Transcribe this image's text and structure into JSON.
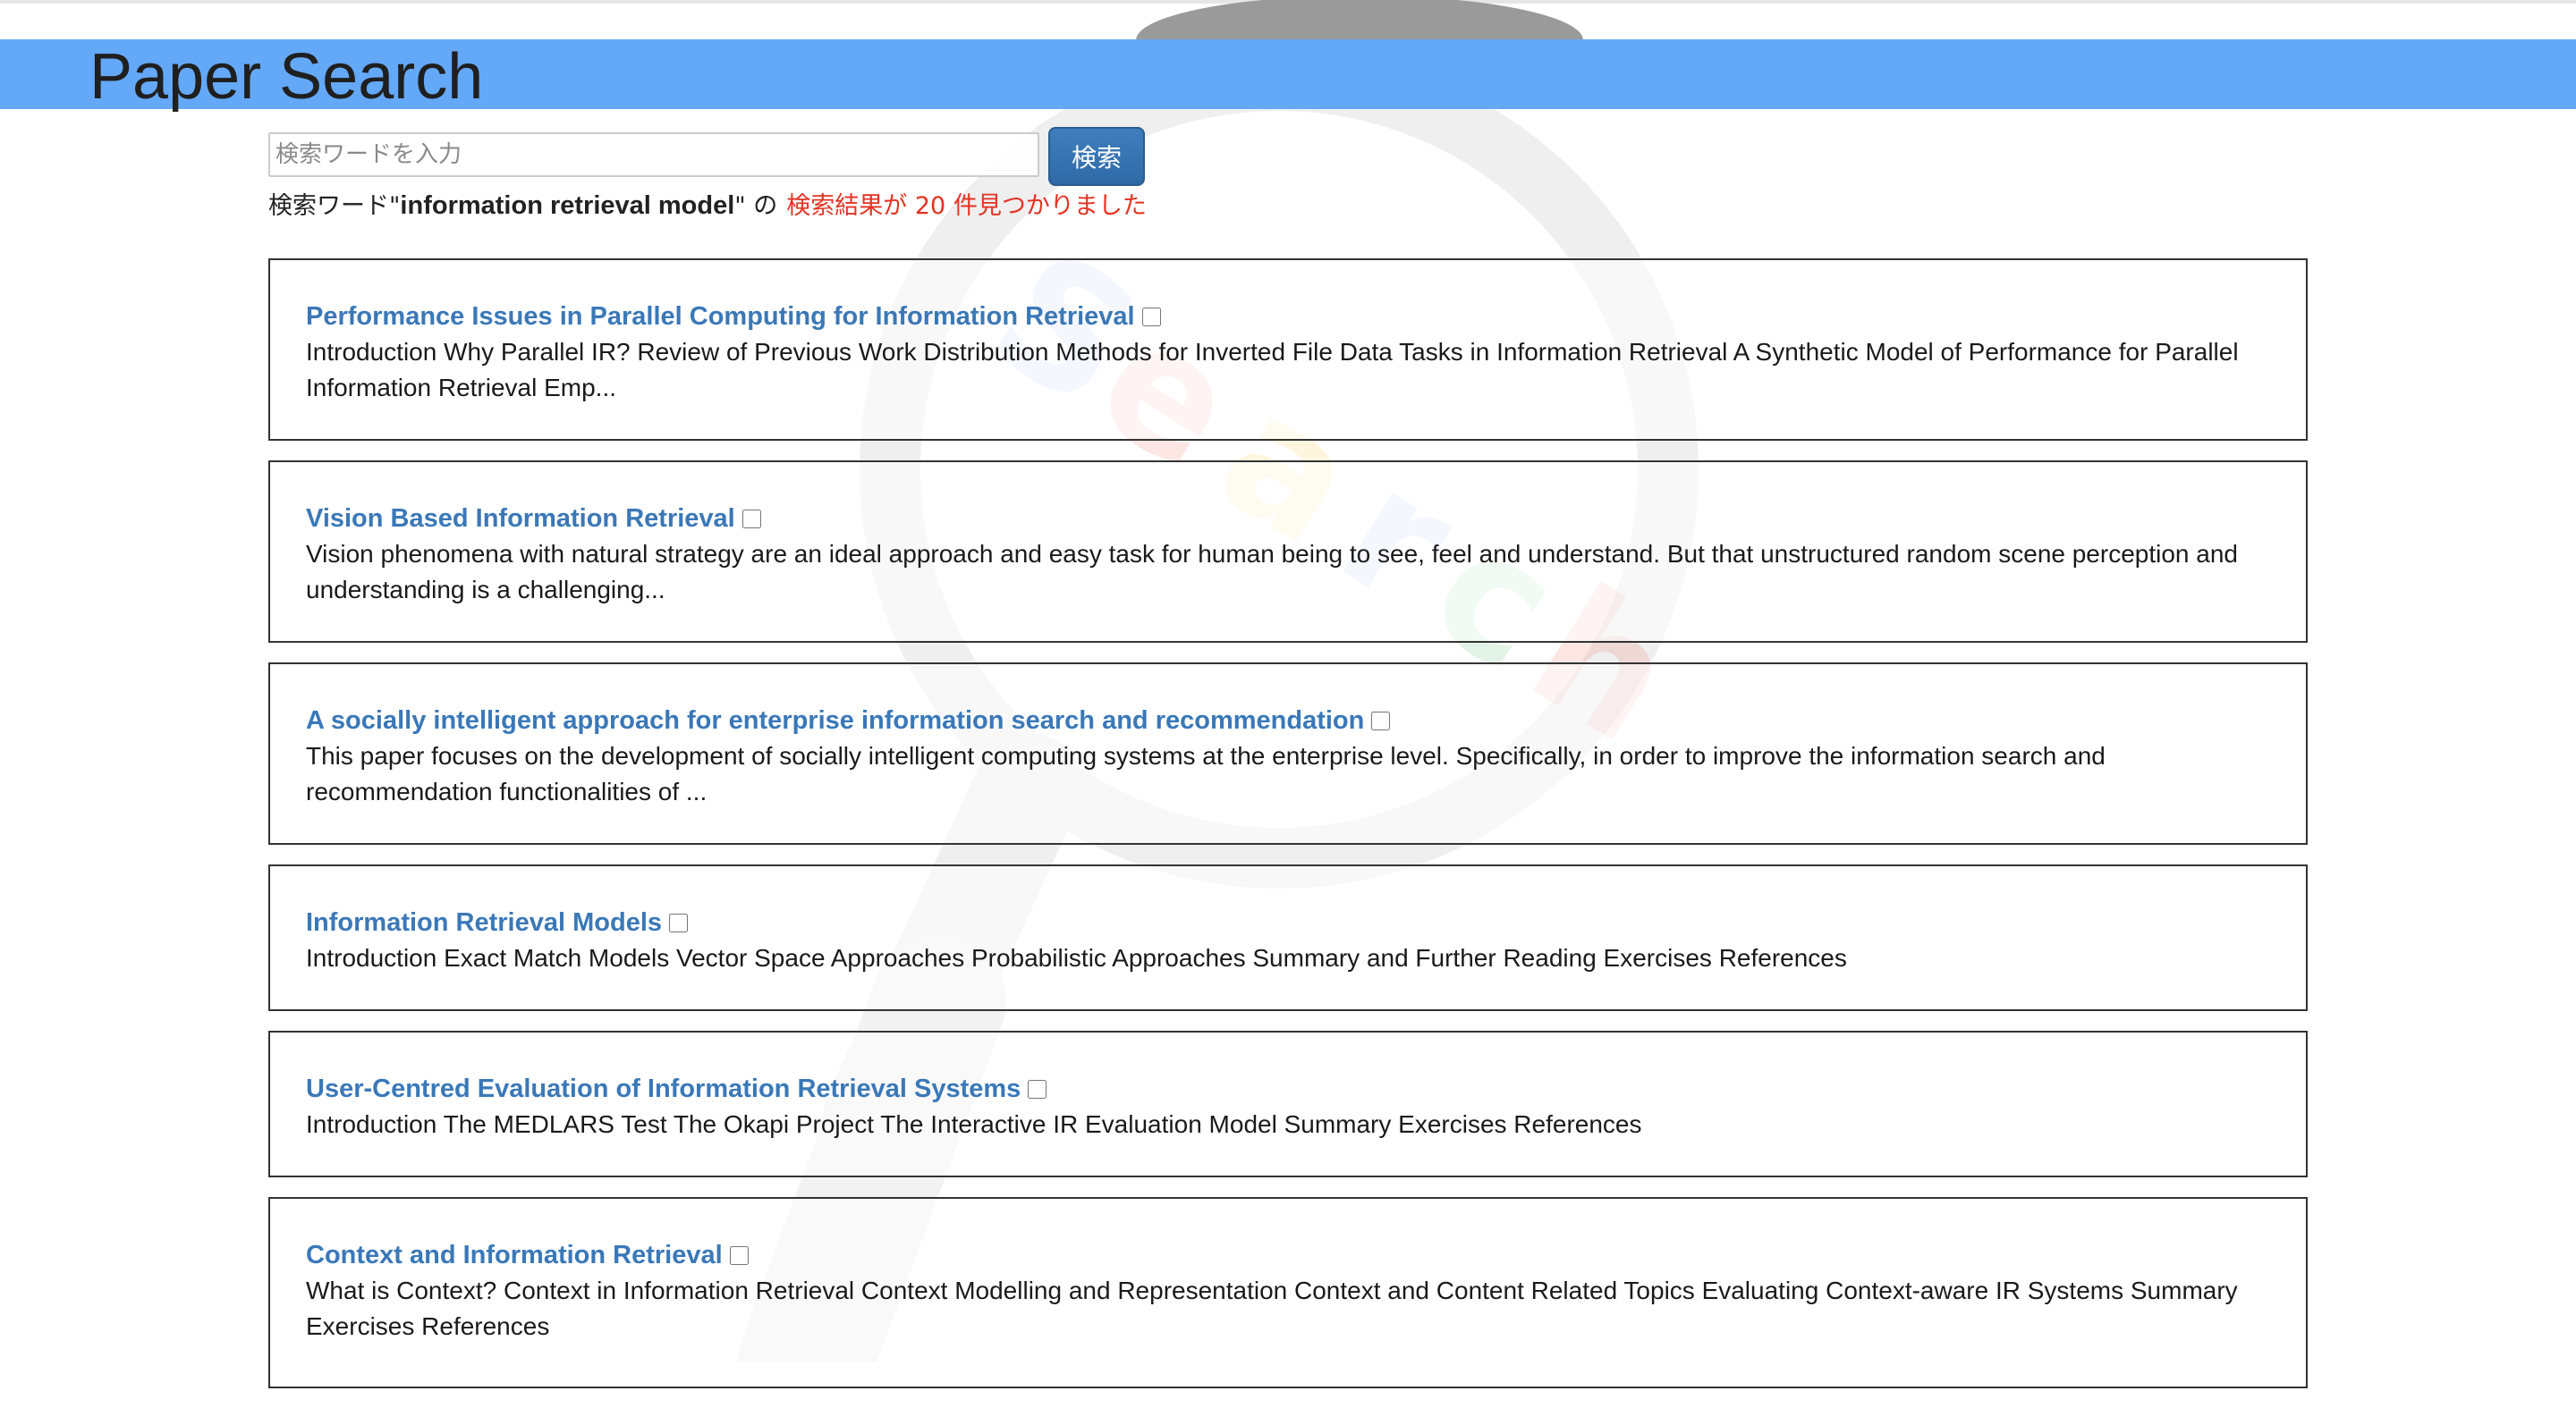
{
  "app": {
    "title": "Paper Search"
  },
  "search": {
    "placeholder": "検索ワードを入力",
    "value": "",
    "button_label": "検索"
  },
  "summary": {
    "prefix": "検索ワード\"",
    "term": "information retrieval model",
    "suffix": "\" の",
    "count_text": "検索結果が 20 件見つかりました"
  },
  "results": [
    {
      "title": "Performance Issues in Parallel Computing for Information Retrieval",
      "abstract": "Introduction Why Parallel IR? Review of Previous Work Distribution Methods for Inverted File Data Tasks in Information Retrieval A Synthetic Model of Performance for Parallel Information Retrieval Emp...",
      "checked": false
    },
    {
      "title": "Vision Based Information Retrieval",
      "abstract": "Vision phenomena with natural strategy are an ideal approach and easy task for human being to see, feel and understand. But that unstructured random scene perception and understanding is a challenging...",
      "checked": false
    },
    {
      "title": "A socially intelligent approach for enterprise information search and recommendation",
      "abstract": "This paper focuses on the development of socially intelligent computing systems at the enterprise level. Specifically, in order to improve the information search and recommendation functionalities of ...",
      "checked": false
    },
    {
      "title": "Information Retrieval Models",
      "abstract": "Introduction Exact Match Models Vector Space Approaches Probabilistic Approaches Summary and Further Reading Exercises References",
      "checked": false
    },
    {
      "title": "User-Centred Evaluation of Information Retrieval Systems",
      "abstract": "Introduction The MEDLARS Test The Okapi Project The Interactive IR Evaluation Model Summary Exercises References",
      "checked": false
    },
    {
      "title": "Context and Information Retrieval",
      "abstract": "What is Context? Context in Information Retrieval Context Modelling and Representation Context and Content Related Topics Evaluating Context-aware IR Systems Summary Exercises References",
      "checked": false
    }
  ],
  "colors": {
    "header_bar": "#64a8f8",
    "title_link": "#3a78b8",
    "count_text": "#e53222",
    "search_button": "#336fab"
  },
  "icons": {
    "watermark": "magnifying-glass-icon"
  }
}
